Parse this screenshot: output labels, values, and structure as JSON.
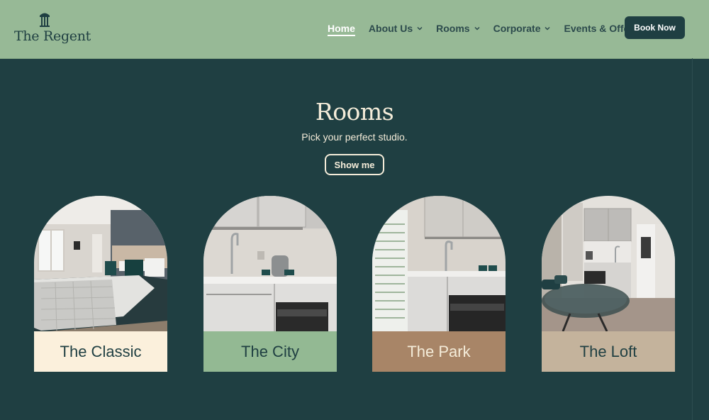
{
  "brand": {
    "name": "The Regent",
    "logo_icon": "column-icon"
  },
  "nav": {
    "items": [
      {
        "label": "Home",
        "active": true,
        "dropdown": false
      },
      {
        "label": "About Us",
        "active": false,
        "dropdown": true
      },
      {
        "label": "Rooms",
        "active": false,
        "dropdown": true
      },
      {
        "label": "Corporate",
        "active": false,
        "dropdown": true
      },
      {
        "label": "Events & Offers",
        "active": false,
        "dropdown": true
      }
    ],
    "cta": "Book Now"
  },
  "section": {
    "title": "Rooms",
    "subtitle": "Pick your perfect studio.",
    "button": "Show me"
  },
  "rooms": [
    {
      "name": "The Classic",
      "label_color": "#fbf0dc",
      "image": "bedroom-photo"
    },
    {
      "name": "The City",
      "label_color": "#93b993",
      "image": "kitchenette-photo"
    },
    {
      "name": "The Park",
      "label_color": "#a88567",
      "image": "kitchen-window-photo"
    },
    {
      "name": "The Loft",
      "label_color": "#c4b39c",
      "image": "loft-kitchen-photo"
    }
  ],
  "colors": {
    "header_bg": "#97b996",
    "page_bg": "#1f3f42",
    "cream": "#f4ecd9"
  }
}
